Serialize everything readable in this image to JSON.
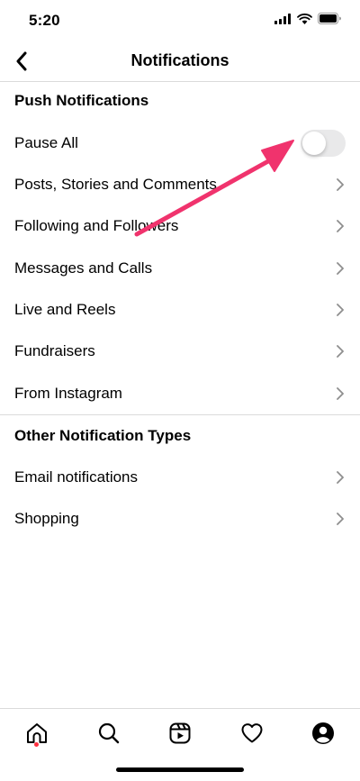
{
  "status_bar": {
    "time": "5:20",
    "icons": [
      "signal-icon",
      "wifi-icon",
      "battery-icon"
    ]
  },
  "header": {
    "title": "Notifications",
    "back_icon": "chevron-left-icon"
  },
  "sections": {
    "push": {
      "title": "Push Notifications",
      "pause_all": {
        "label": "Pause All",
        "enabled": false
      },
      "items": [
        {
          "label": "Posts, Stories and Comments"
        },
        {
          "label": "Following and Followers"
        },
        {
          "label": "Messages and Calls"
        },
        {
          "label": "Live and Reels"
        },
        {
          "label": "Fundraisers"
        },
        {
          "label": "From Instagram"
        }
      ]
    },
    "other": {
      "title": "Other Notification Types",
      "items": [
        {
          "label": "Email notifications"
        },
        {
          "label": "Shopping"
        }
      ]
    }
  },
  "annotation": {
    "color": "#f0336d",
    "points_to": "pause-all-toggle"
  },
  "tab_bar": {
    "tabs": [
      "home-icon",
      "search-icon",
      "reels-icon",
      "heart-icon",
      "profile-icon"
    ],
    "active": "home-icon",
    "notification_dot_color": "#ff3040"
  }
}
